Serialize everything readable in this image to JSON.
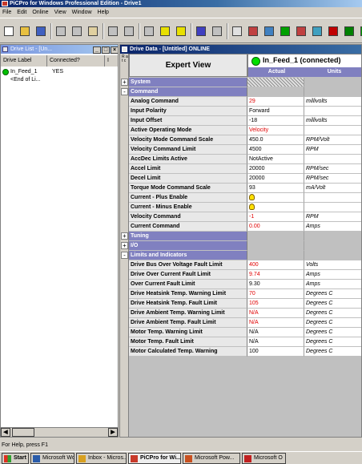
{
  "app": {
    "title": "PiCPro for Windows Professional Edition - Drive1"
  },
  "menu": [
    "File",
    "Edit",
    "Online",
    "View",
    "Window",
    "Help"
  ],
  "toolbar": {
    "icons": [
      "new-file-icon",
      "open-folder-icon",
      "save-icon",
      "cut-icon",
      "copy-icon",
      "paste-icon",
      "undo-icon",
      "redo-icon",
      "print-icon",
      "help-icon",
      "context-help-icon",
      "library-icon",
      "grid-icon",
      "table-icon",
      "monitor-icon",
      "drive-icon",
      "online-icon",
      "ladder-icon",
      "function-icon",
      "stop-icon",
      "run-icon",
      "module-icon"
    ]
  },
  "drive_list": {
    "title": "Drive List - [Un...",
    "columns": [
      "Drive Label",
      "Connected?",
      "I"
    ],
    "items": [
      {
        "label": "In_Feed_1",
        "connected": "YES"
      },
      {
        "label": "<End of Li..."
      }
    ]
  },
  "drive_data": {
    "title": "Drive Data - [Untitled] ONLINE",
    "gutter_label": "R a t c",
    "view_label": "Expert View",
    "device": "In_Feed_1 (connected)",
    "col_actual": "Actual",
    "col_units": "Units",
    "rows": [
      {
        "type": "section",
        "label": "System",
        "expand": "+"
      },
      {
        "type": "section",
        "label": "Command",
        "expand": "-"
      },
      {
        "type": "param",
        "label": "Analog Command",
        "value": "29",
        "unit": "millivolts",
        "value_red": true
      },
      {
        "type": "param",
        "label": "Input Polarity",
        "value": "Forward",
        "unit": ""
      },
      {
        "type": "param",
        "label": "Input Offset",
        "value": "-18",
        "unit": "millivolts"
      },
      {
        "type": "param",
        "label": "Active Operating Mode",
        "value": "Velocity",
        "unit": "",
        "value_red": true
      },
      {
        "type": "param",
        "label": "Velocity Mode Command Scale",
        "value": "450.0",
        "unit": "RPM/Volt"
      },
      {
        "type": "param",
        "label": "Velocity Command Limit",
        "value": "4500",
        "unit": "RPM"
      },
      {
        "type": "param",
        "label": "AccDec Limits Active",
        "value": "NotActive",
        "unit": ""
      },
      {
        "type": "param",
        "label": "Accel Limit",
        "value": "20000",
        "unit": "RPM/sec"
      },
      {
        "type": "param",
        "label": "Decel Limit",
        "value": "20000",
        "unit": "RPM/sec"
      },
      {
        "type": "param",
        "label": "Torque Mode Command Scale",
        "value": "93",
        "unit": "mA/Volt"
      },
      {
        "type": "param",
        "label": "Current - Plus Enable",
        "value": "",
        "unit": "",
        "bulb": true
      },
      {
        "type": "param",
        "label": "Current - Minus Enable",
        "value": "",
        "unit": "",
        "bulb": true
      },
      {
        "type": "param",
        "label": "Velocity Command",
        "value": "-1",
        "unit": "RPM",
        "value_red": true
      },
      {
        "type": "param",
        "label": "Current Command",
        "value": "0.00",
        "unit": "Amps",
        "value_red": true
      },
      {
        "type": "section",
        "label": "Tuning",
        "expand": "+"
      },
      {
        "type": "section",
        "label": "I/O",
        "expand": "+"
      },
      {
        "type": "section",
        "label": "Limits and Indicators",
        "expand": "-"
      },
      {
        "type": "param",
        "label": "Drive Bus Over Voltage Fault Limit",
        "value": "400",
        "unit": "Volts",
        "value_red": true
      },
      {
        "type": "param",
        "label": "Drive Over Current Fault Limit",
        "value": "9.74",
        "unit": "Amps",
        "value_red": true
      },
      {
        "type": "param",
        "label": "Over Current Fault Limit",
        "value": "9.30",
        "unit": "Amps"
      },
      {
        "type": "param",
        "label": "Drive Heatsink Temp. Warning Limit",
        "value": "70",
        "unit": "Degrees C",
        "value_red": true
      },
      {
        "type": "param",
        "label": "Drive Heatsink Temp. Fault Limit",
        "value": "105",
        "unit": "Degrees C",
        "value_red": true
      },
      {
        "type": "param",
        "label": "Drive Ambient Temp. Warning Limit",
        "value": "N/A",
        "unit": "Degrees C",
        "value_red": true
      },
      {
        "type": "param",
        "label": "Drive Ambient Temp. Fault Limit",
        "value": "N/A",
        "unit": "Degrees C",
        "value_red": true
      },
      {
        "type": "param",
        "label": "Motor Temp. Warning Limit",
        "value": "N/A",
        "unit": "Degrees C"
      },
      {
        "type": "param",
        "label": "Motor Temp. Fault Limit",
        "value": "N/A",
        "unit": "Degrees C"
      },
      {
        "type": "param",
        "label": "Motor Calculated Temp. Warning",
        "value": "100",
        "unit": "Degrees C"
      }
    ]
  },
  "status": {
    "text": "For Help, press F1"
  },
  "taskbar": {
    "start": "Start",
    "items": [
      {
        "label": "Microsoft Wor...",
        "icon": "word-icon",
        "color": "#2a5caa"
      },
      {
        "label": "Inbox - Micros...",
        "icon": "outlook-icon",
        "color": "#d8a020"
      },
      {
        "label": "PiCPro for Wi...",
        "icon": "picpro-icon",
        "color": "#c83a2a",
        "active": true
      },
      {
        "label": "Microsoft Pow...",
        "icon": "powerpoint-icon",
        "color": "#c85020"
      },
      {
        "label": "Microsoft O",
        "icon": "office-icon",
        "color": "#c02020"
      }
    ]
  }
}
